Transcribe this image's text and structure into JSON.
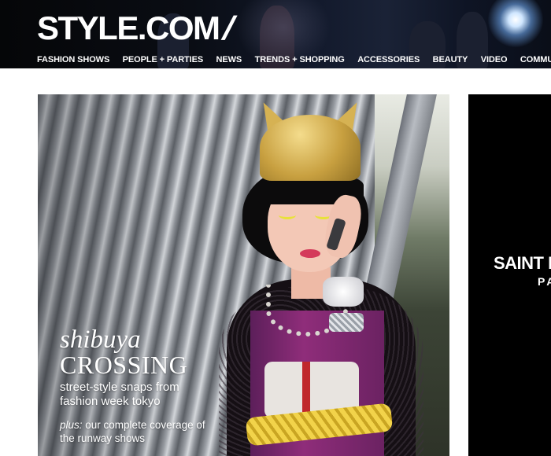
{
  "header": {
    "logo_text": "STYLE.COM",
    "logo_slash": "/",
    "nav_items": [
      "FASHION SHOWS",
      "PEOPLE + PARTIES",
      "NEWS",
      "TRENDS + SHOPPING",
      "ACCESSORIES",
      "BEAUTY",
      "VIDEO",
      "COMMUNITY"
    ]
  },
  "hero": {
    "title_line1": "shibuya",
    "title_line2": "CROSSING",
    "description": "street-style snaps from fashion week tokyo",
    "plus_prefix": "plus:",
    "plus_text": " our complete coverage of the runway shows"
  },
  "promo": {
    "brand": "SAINT LAURENT",
    "sub": "PARIS"
  },
  "colors": {
    "header_bg": "#0a0e18",
    "page_bg": "#ffffff",
    "promo_bg": "#000000",
    "text_light": "#ffffff"
  }
}
